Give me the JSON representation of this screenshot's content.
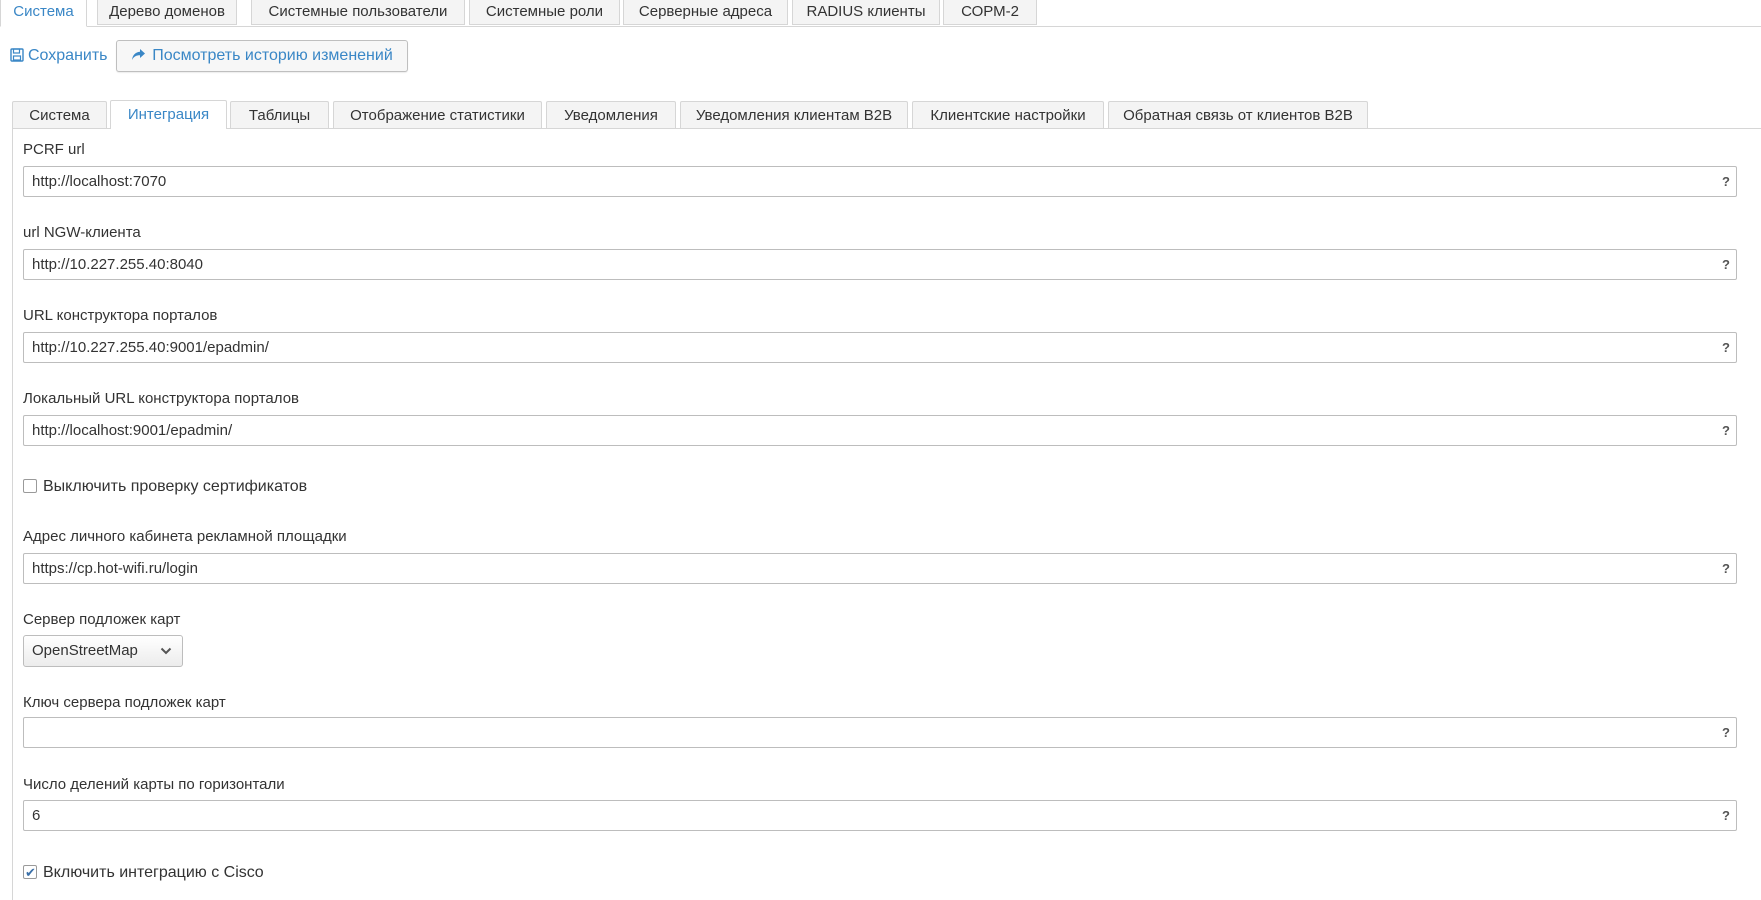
{
  "top_tabs": [
    {
      "label": "Система",
      "active": true
    },
    {
      "label": "Дерево доменов",
      "active": false
    },
    {
      "label": "Системные пользователи",
      "active": false
    },
    {
      "label": "Системные роли",
      "active": false
    },
    {
      "label": "Серверные адреса",
      "active": false
    },
    {
      "label": "RADIUS клиенты",
      "active": false
    },
    {
      "label": "СОРМ-2",
      "active": false
    }
  ],
  "toolbar": {
    "save_label": "Сохранить",
    "history_label": "Посмотреть историю изменений"
  },
  "inner_tabs": [
    {
      "label": "Система",
      "active": false
    },
    {
      "label": "Интеграция",
      "active": true
    },
    {
      "label": "Таблицы",
      "active": false
    },
    {
      "label": "Отображение статистики",
      "active": false
    },
    {
      "label": "Уведомления",
      "active": false
    },
    {
      "label": "Уведомления клиентам B2B",
      "active": false
    },
    {
      "label": "Клиентские настройки",
      "active": false
    },
    {
      "label": "Обратная связь от клиентов B2B",
      "active": false
    }
  ],
  "form": {
    "pcrf_url": {
      "label": "PCRF url",
      "value": "http://localhost:7070"
    },
    "ngw_url": {
      "label": "url NGW-клиента",
      "value": "http://10.227.255.40:8040"
    },
    "portal_url": {
      "label": "URL конструктора порталов",
      "value": "http://10.227.255.40:9001/epadmin/"
    },
    "local_portal_url": {
      "label": "Локальный URL конструктора порталов",
      "value": "http://localhost:9001/epadmin/"
    },
    "disable_cert_check": {
      "label": "Выключить проверку сертификатов",
      "checked": false
    },
    "ad_cabinet_url": {
      "label": "Адрес личного кабинета рекламной площадки",
      "value": "https://cp.hot-wifi.ru/login"
    },
    "map_server": {
      "label": "Сервер подложек карт",
      "value": "OpenStreetMap"
    },
    "map_key": {
      "label": "Ключ сервера подложек карт",
      "value": ""
    },
    "map_divisions": {
      "label": "Число делений карты по горизонтали",
      "value": "6"
    },
    "cisco_integration": {
      "label": "Включить интеграцию с Cisco",
      "checked": true
    }
  },
  "help_glyph": "?",
  "check_glyph": "✔",
  "colors": {
    "accent": "#3a87c6",
    "border": "#d6d6d6"
  }
}
